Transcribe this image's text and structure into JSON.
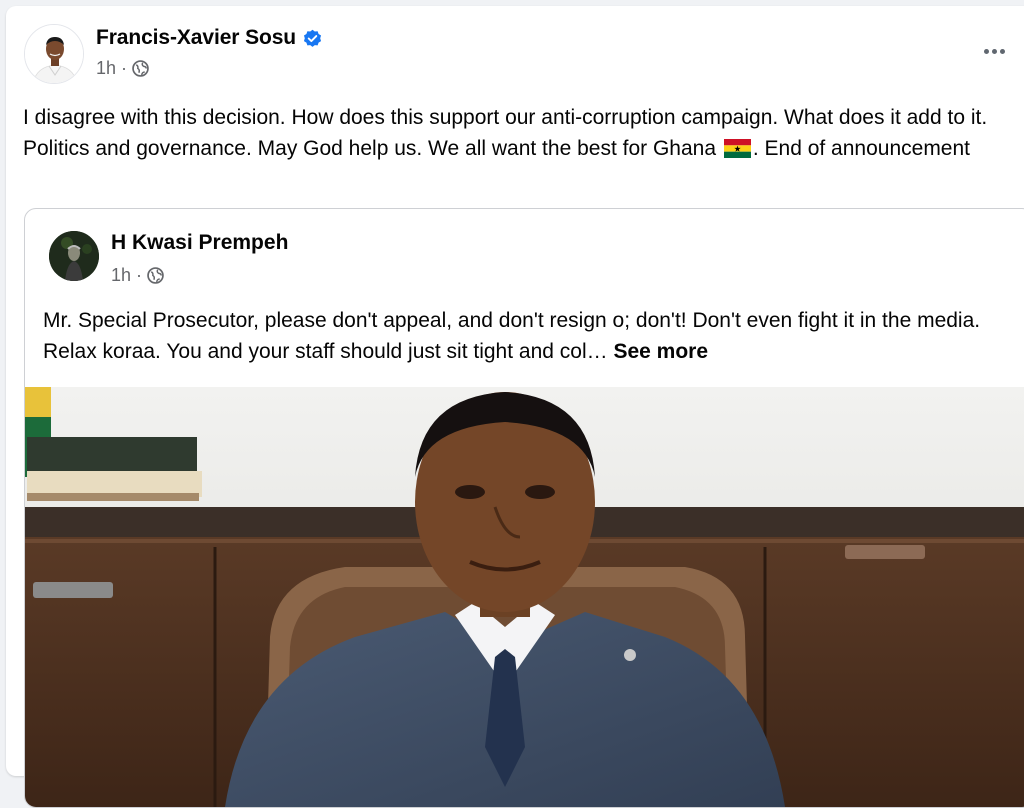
{
  "post": {
    "author": "Francis-Xavier Sosu",
    "time": "1h",
    "separator": "·",
    "text_part1": "I disagree with this decision. How does this support our anti-corruption campaign. What does it add to it. Politics and governance. May God help us. We all want the best for Ghana",
    "text_part2": ". End of announcement",
    "flag_icon": "ghana-flag-icon",
    "verified_icon": "verified-badge-icon",
    "privacy_icon": "globe-icon",
    "more_icon": "more-options-icon"
  },
  "shared_post": {
    "author": "H Kwasi Prempeh",
    "time": "1h",
    "separator": "·",
    "privacy_icon": "globe-icon",
    "text": "Mr. Special Prosecutor, please don't appeal, and don't resign o; don't!  Don't even fight it in the media. Relax koraa. You and your staff should just sit tight and col…",
    "see_more": "See more"
  },
  "colors": {
    "background": "#f0f2f5",
    "card": "#ffffff",
    "verified_blue": "#1877f2",
    "secondary_text": "#65676b",
    "primary_text": "#050505"
  }
}
